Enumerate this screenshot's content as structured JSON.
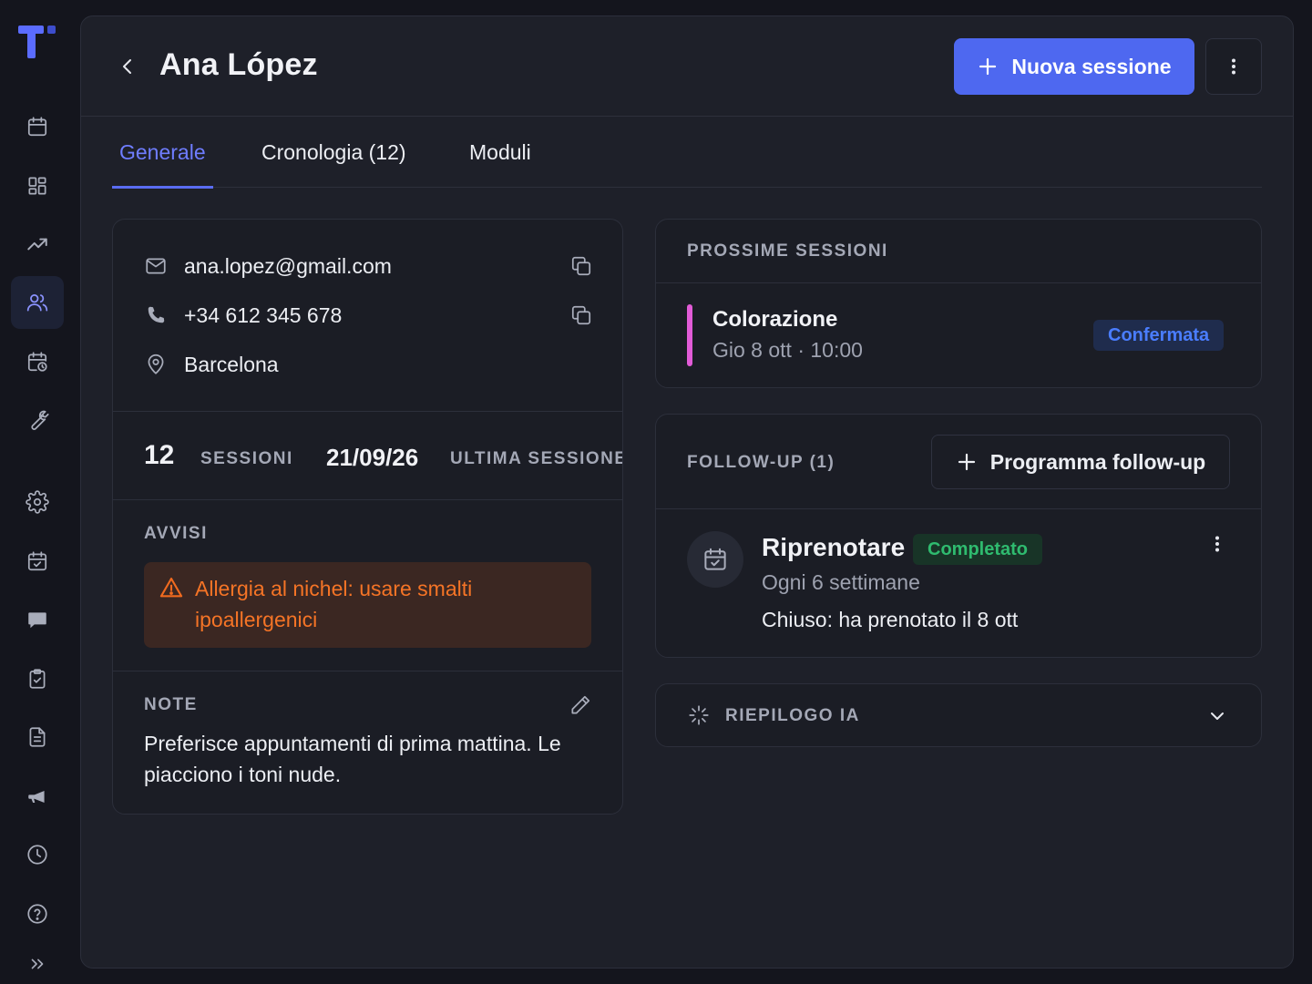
{
  "header": {
    "title": "Ana López",
    "new_session_label": "Nuova sessione"
  },
  "tabs": [
    {
      "label": "Generale"
    },
    {
      "label": "Cronologia (12)"
    },
    {
      "label": "Moduli"
    }
  ],
  "contact": {
    "email": "ana.lopez@gmail.com",
    "phone": "+34 612 345 678",
    "city": "Barcelona"
  },
  "stats": {
    "sessions_count": "12",
    "sessions_label": "SESSIONI",
    "last_session_date": "21/09/26",
    "last_session_label": "ULTIMA SESSIONE"
  },
  "alerts": {
    "title": "AVVISI",
    "text": "Allergia al nichel: usare smalti ipoallergenici"
  },
  "notes": {
    "title": "NOTE",
    "text": "Preferisce appuntamenti di prima mattina. Le piacciono i toni nude."
  },
  "upcoming": {
    "title": "PROSSIME SESSIONI",
    "item": {
      "service": "Colorazione",
      "datetime": "Gio 8 ott · 10:00",
      "status": "Confermata",
      "accent_color": "#e25bd7"
    }
  },
  "followup": {
    "title": "FOLLOW-UP (1)",
    "schedule_label": "Programma follow-up",
    "item": {
      "title": "Riprenotare",
      "status": "Completato",
      "frequency": "Ogni 6 settimane",
      "note": "Chiuso: ha prenotato il 8 ott"
    }
  },
  "ai_summary": {
    "title": "RIEPILOGO IA"
  },
  "colors": {
    "accent": "#4e68f0",
    "active_tab": "#6f7dff",
    "alert": "#f57426",
    "confirmed": "#4a7dff",
    "completed": "#2fbb6f"
  }
}
